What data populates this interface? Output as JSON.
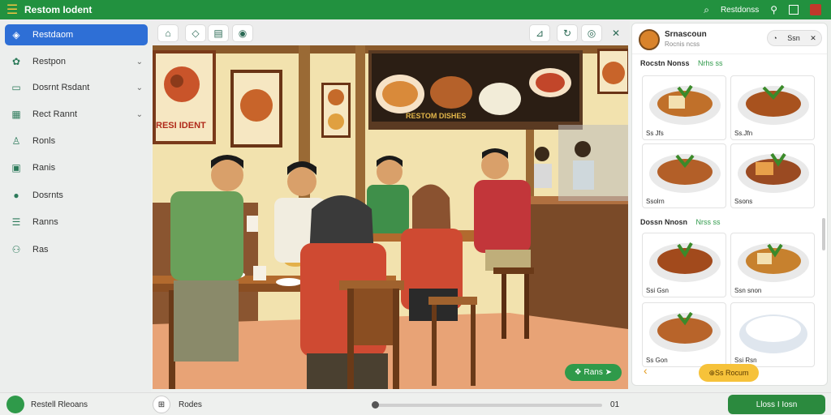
{
  "app": {
    "title": "Restom Iodent"
  },
  "topbar": {
    "search_label": "Restdonss"
  },
  "sidebar": {
    "items": [
      {
        "label": "Restdaom",
        "icon": "compass-icon",
        "active": true,
        "chevron": false
      },
      {
        "label": "Restpon",
        "icon": "food-icon",
        "active": false,
        "chevron": true
      },
      {
        "label": "Dosrnt Rsdant",
        "icon": "message-icon",
        "active": false,
        "chevron": true
      },
      {
        "label": "Rect Rannt",
        "icon": "calendar-icon",
        "active": false,
        "chevron": true
      },
      {
        "label": "Ronls",
        "icon": "person-icon",
        "active": false,
        "chevron": false
      },
      {
        "label": "Ranis",
        "icon": "image-icon",
        "active": false,
        "chevron": false
      },
      {
        "label": "Dosrnts",
        "icon": "globe-icon",
        "active": false,
        "chevron": false
      },
      {
        "label": "Ranns",
        "icon": "list-icon",
        "active": false,
        "chevron": false
      },
      {
        "label": "Ras",
        "icon": "users-icon",
        "active": false,
        "chevron": false
      }
    ]
  },
  "scene": {
    "sign_text": "RESI IDENT",
    "menu_board_text": "RESTOM DISHES",
    "tag_label": "Rans"
  },
  "panel": {
    "name": "Srnascoun",
    "subtitle": "Rocnis ncss",
    "control_label": "Ssn",
    "section1": {
      "title": "Rocstn Nonss",
      "tag": "Nrhs ss"
    },
    "section2": {
      "title": "Dossn Nnosn",
      "tag": "Nrss ss"
    },
    "cards1": [
      "Ss Jfs",
      "Ss.Jfn",
      "Ssolrn",
      "Ssons"
    ],
    "cards2": [
      "Ssi Gsn",
      "Ssn snon",
      "Ss Gon",
      "Ssi Rsn"
    ],
    "button_label": "Ss Rocum"
  },
  "bottombar": {
    "brand": "Restell Rleoans",
    "label": "Rodes",
    "page_num": "01",
    "action_label": "Lloss I Iosn"
  },
  "colors": {
    "brand_green": "#22913f",
    "accent_blue": "#2e6fd6",
    "accent_yellow": "#f6c23a"
  }
}
